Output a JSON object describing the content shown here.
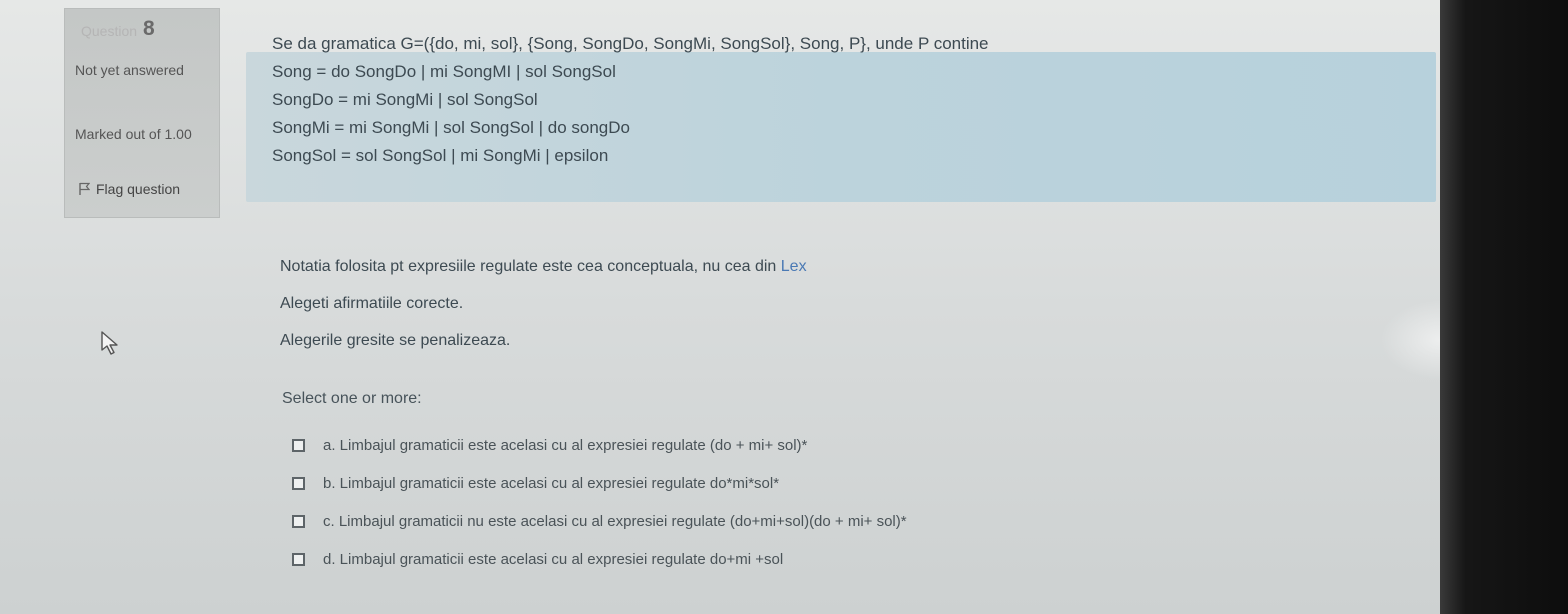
{
  "question_info": {
    "label": "Question",
    "number": "8",
    "state": "Not yet answered",
    "marked_out_of": "Marked out of 1.00",
    "flag_label": "Flag question"
  },
  "question": {
    "grammar_intro": "Se da gramatica G=({do, mi, sol}, {Song, SongDo, SongMi, SongSol}, Song, P}, unde P contine",
    "productions": [
      "Song = do SongDo | mi SongMI | sol SongSol",
      "SongDo = mi SongMi | sol SongSol",
      "SongMi = mi SongMi | sol SongSol | do songDo",
      "SongSol = sol SongSol | mi SongMi | epsilon"
    ],
    "note_prefix": "Notatia folosita pt expresiile regulate este cea conceptuala, nu cea din",
    "note_link": "Lex",
    "instruction": "Alegeti afirmatiile corecte.",
    "penalty": "Alegerile gresite se penalizeaza."
  },
  "answers": {
    "prompt": "Select one or more:",
    "options": [
      {
        "text": "a. Limbajul gramaticii este acelasi cu al expresiei regulate (do + mi+ sol)*",
        "checked": false
      },
      {
        "text": "b. Limbajul gramaticii este acelasi cu al expresiei regulate do*mi*sol*",
        "checked": false
      },
      {
        "text": "c. Limbajul gramaticii nu este acelasi cu al expresiei regulate (do+mi+sol)(do + mi+ sol)*",
        "checked": false
      },
      {
        "text": "d. Limbajul gramaticii este acelasi cu al expresiei regulate do+mi +sol",
        "checked": false
      }
    ]
  },
  "colors": {
    "formula_bg": "#bcd3dc",
    "link": "#4a79b4",
    "text": "#3d4a52"
  }
}
